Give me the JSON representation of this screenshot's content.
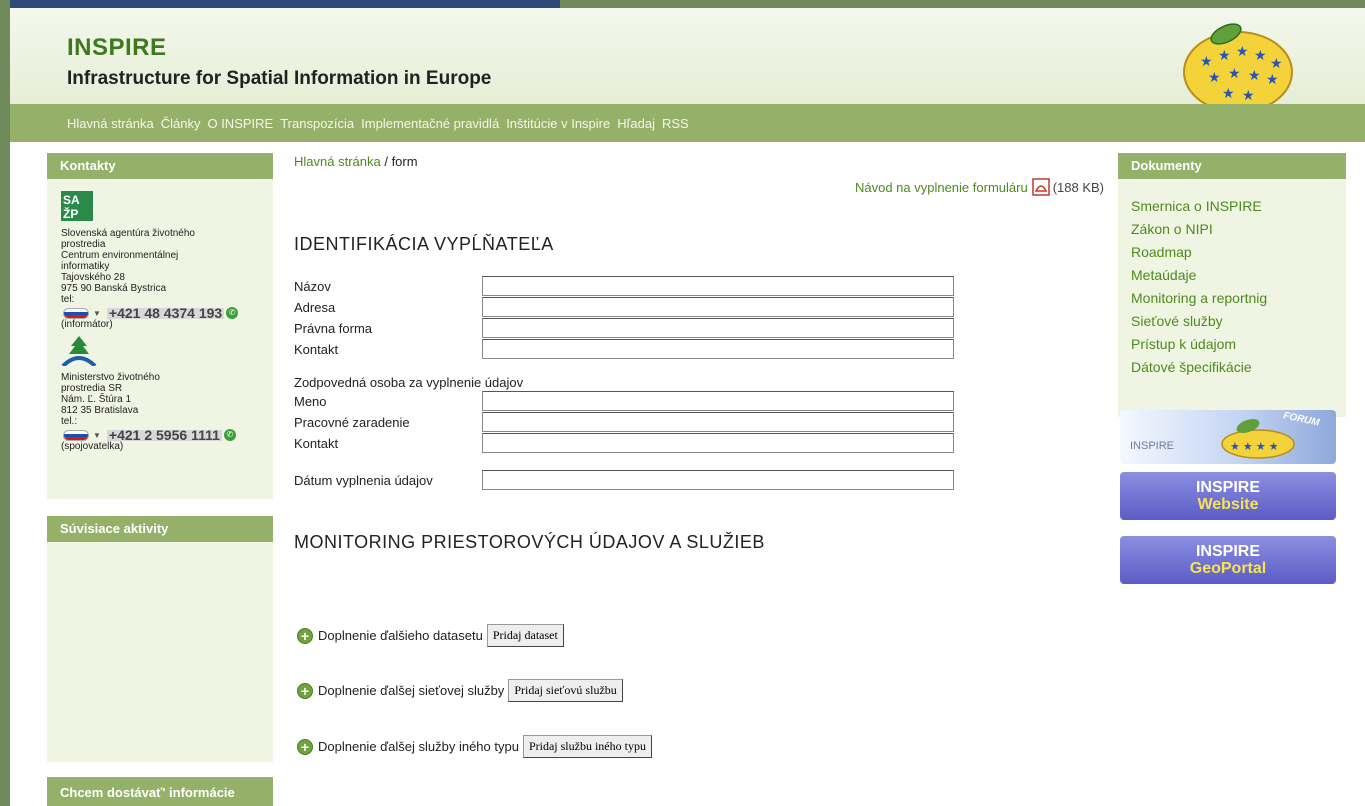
{
  "header": {
    "title": "INSPIRE",
    "subtitle": "Infrastructure for Spatial Information in Europe"
  },
  "nav": [
    "Hlavná stránka",
    "Články",
    "O INSPIRE",
    "Transpozícia",
    "Implementačné pravidlá",
    "Inštitúcie v Inspire",
    "Hľadaj",
    "RSS"
  ],
  "kontakty": {
    "title": "Kontakty",
    "org1": {
      "lines": [
        "Slovenská agentúra životného",
        "prostredia",
        "Centrum environmentálnej",
        "informatiky",
        "Tajovského 28",
        "975 90  Banská Bystrica",
        "tel:"
      ],
      "phone": "+421 48  4374 193",
      "note": "(informátor)"
    },
    "org2": {
      "lines": [
        "Ministerstvo životného",
        "prostredia SR",
        "Nám. Ľ. Štúra 1",
        "812 35 Bratislava",
        "tel.:"
      ],
      "phone": "+421 2 5956 1111",
      "note": "(spojovatelka)"
    }
  },
  "suvisiace": {
    "title": "Súvisiace aktivity"
  },
  "chcem": {
    "title": "Chcem dostávať' informácie"
  },
  "breadcrumb": {
    "home": "Hlavná stránka",
    "sep": " / ",
    "current": "form"
  },
  "navod": {
    "link": "Návod na vyplnenie formuláru",
    "size": "(188 KB)"
  },
  "form": {
    "section1": "IDENTIFIKÁCIA VYPĹŇATEĽA",
    "nazov": "Názov",
    "adresa": "Adresa",
    "pravna": "Právna forma",
    "kontakt1": "Kontakt",
    "zodpovedna": "Zodpovedná osoba za vyplnenie údajov",
    "meno": "Meno",
    "pracovne": "Pracovné zaradenie",
    "kontakt2": "Kontakt",
    "datum": "Dátum vyplnenia údajov",
    "section2": "MONITORING PRIESTOROVÝCH ÚDAJOV A SLUŽIEB",
    "add1_text": "Doplnenie ďalšieho datasetu",
    "add1_btn": "Pridaj dataset",
    "add2_text": "Doplnenie ďalšej sieťovej služby",
    "add2_btn": "Pridaj sieťovú službu",
    "add3_text": "Doplnenie ďalšej služby iného typu",
    "add3_btn": "Pridaj službu iného typu"
  },
  "dokumenty": {
    "title": "Dokumenty",
    "links": [
      "Smernica o INSPIRE",
      "Zákon o NIPI",
      "Roadmap",
      "Metaúdaje",
      "Monitoring a reportnig",
      "Sieťové služby",
      "Prístup k údajom",
      "Dátové špecifikácie"
    ]
  },
  "banners": {
    "forum_label": "INSPIRE",
    "forum_tag": "FORUM",
    "web_line1": "INSPIRE",
    "web_line2": "Website",
    "geo_line1": "INSPIRE",
    "geo_line2": "GeoPortal"
  },
  "colors": {
    "brand_green": "#3c7a1d",
    "nav_green": "#95b069",
    "link_green": "#4c8a1f",
    "banner_blue": "#5c5cc6"
  }
}
